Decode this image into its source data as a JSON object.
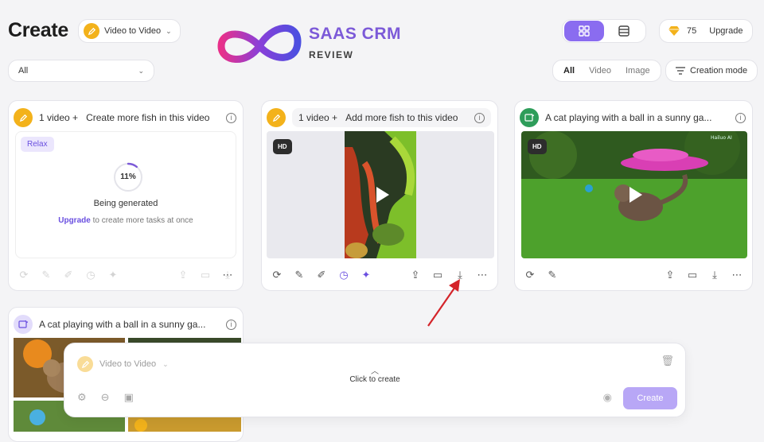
{
  "header": {
    "title": "Create",
    "mode_label": "Video to Video",
    "filter_value": "All"
  },
  "logo": {
    "line1": "SAAS CRM",
    "line2": "REVIEW"
  },
  "top_right": {
    "credits": "75",
    "upgrade_label": "Upgrade",
    "segments": [
      "All",
      "Video",
      "Image"
    ],
    "creation_mode": "Creation mode"
  },
  "cards": [
    {
      "count": "1 video +",
      "prompt": "Create more fish in this video",
      "tag": "Relax",
      "progress": "11%",
      "progress_value": 0.11,
      "status": "Being generated",
      "upgrade_link": "Upgrade",
      "upgrade_rest": " to create more tasks at once"
    },
    {
      "count": "1 video +",
      "prompt": "Add more fish to this video",
      "hd": "HD"
    },
    {
      "prompt": "A cat playing with a ball in a sunny ga...",
      "hd": "HD",
      "watermark": "Hailuo AI"
    },
    {
      "prompt": "A cat playing with a ball in a sunny ga..."
    }
  ],
  "prompt_bar": {
    "mode_label": "Video to Video",
    "center_label": "Click to create",
    "create_label": "Create"
  },
  "colors": {
    "accent": "#8a6cf0",
    "yellow": "#f3b21b",
    "green": "#2e9d5a",
    "arrow": "#d4242a"
  }
}
